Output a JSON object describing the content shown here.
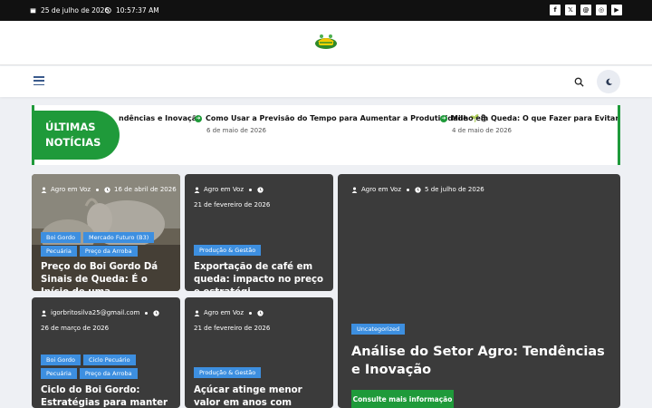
{
  "topbar": {
    "date": "25 de julho de 2026",
    "time": "10:57:37 AM",
    "socials": [
      {
        "icon": "facebook-icon",
        "glyph": "f"
      },
      {
        "icon": "x-icon",
        "glyph": "𝕏"
      },
      {
        "icon": "threads-icon",
        "glyph": "@"
      },
      {
        "icon": "instagram-icon",
        "glyph": "◎"
      },
      {
        "icon": "youtube-icon",
        "glyph": "▶"
      }
    ]
  },
  "ticker": {
    "badge_line1": "ÚLTIMAS",
    "badge_line2": "NOTÍCIAS",
    "items": [
      {
        "title": "ndências e Inovação",
        "date": ""
      },
      {
        "title": "Como Usar a Previsão do Tempo para Aumentar a Produtividade 🌱🌦",
        "date": "6 de maio de 2026"
      },
      {
        "title": "Milho em Queda: O que Fazer para Evitar Prej",
        "date": "4 de maio de 2026"
      }
    ]
  },
  "cards": [
    {
      "author": "Agro em Voz",
      "date": "16 de abril de 2026",
      "tags": [
        "Boi Gordo",
        "Mercado Futuro (B3)",
        "Pecuária",
        "Preço da Arroba"
      ],
      "title": "Preço do Boi Gordo Dá Sinais de Queda: É o Início de uma..."
    },
    {
      "author": "Agro em Voz",
      "date": "21 de fevereiro de 2026",
      "tags": [
        "Produção & Gestão"
      ],
      "title": "Exportação de café em queda: impacto no preço e estratégi..."
    },
    {
      "author": "Agro em Voz",
      "date": "5 de julho de 2026",
      "tags": [
        "Uncategorized"
      ],
      "title": "Análise do Setor Agro: Tendências e Inovação",
      "cta": "Consulte mais informação"
    },
    {
      "author": "igorbritosilva25@gmail.com",
      "date": "26 de março de 2026",
      "tags": [
        "Boi Gordo",
        "Ciclo Pecuário",
        "Pecuária",
        "Preço da Arroba"
      ],
      "title": "Ciclo do Boi Gordo: Estratégias para manter a..."
    },
    {
      "author": "Agro em Voz",
      "date": "21 de fevereiro de 2026",
      "tags": [
        "Produção & Gestão"
      ],
      "title": "Açúcar atinge menor valor em anos com mercado fraco e..."
    }
  ],
  "colors": {
    "accent": "#1f9a3a",
    "tag": "#3d8fe0",
    "card": "#3b3b3b"
  }
}
